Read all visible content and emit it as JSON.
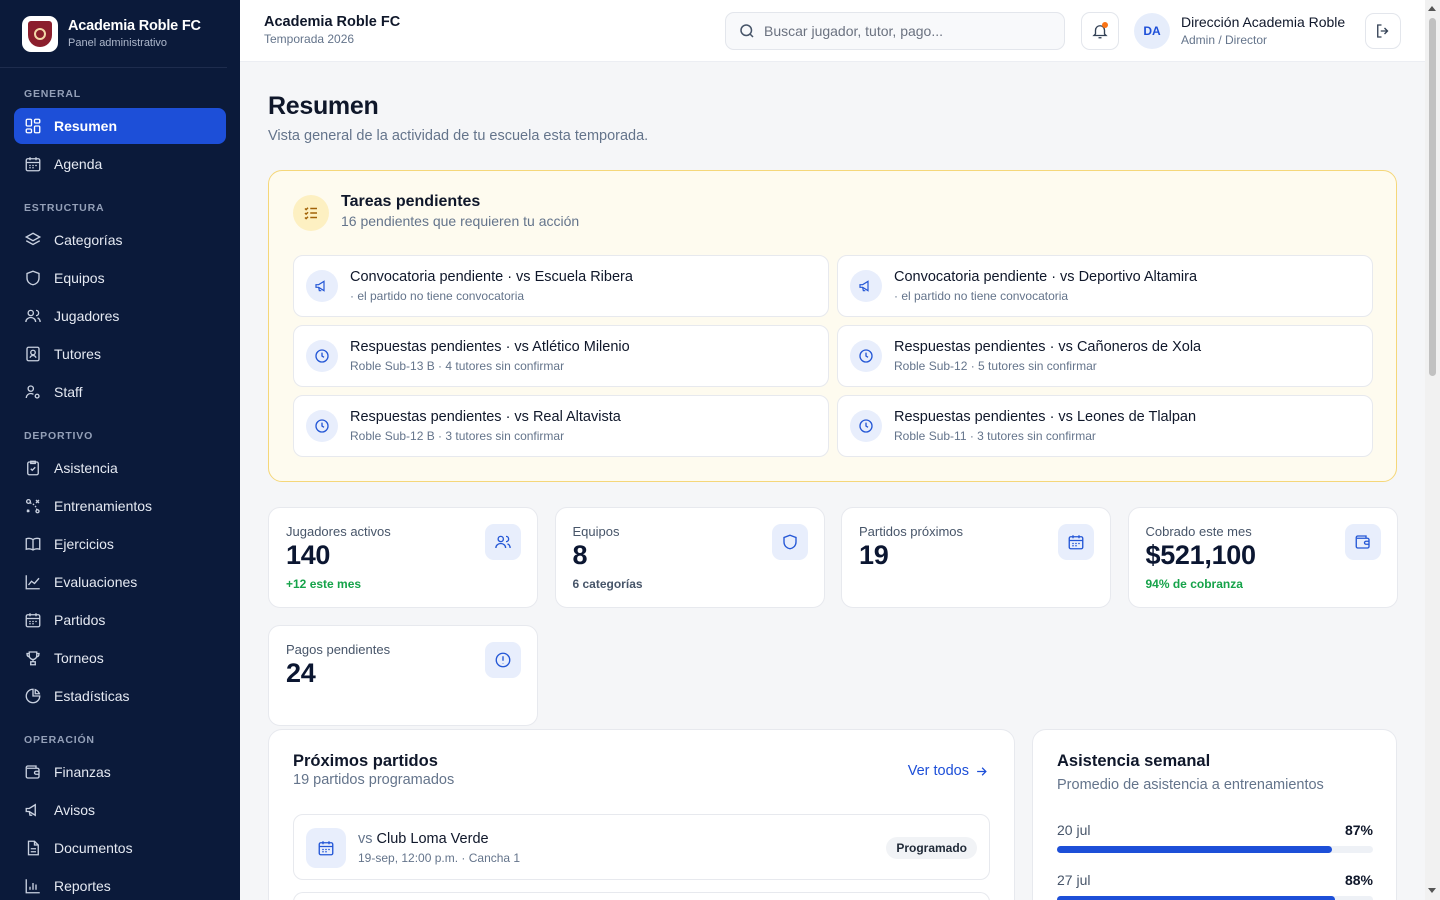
{
  "brand": {
    "title": "Academia Roble FC",
    "subtitle": "Panel administrativo"
  },
  "sidebar": {
    "sections": [
      {
        "label": "GENERAL",
        "items": [
          {
            "label": "Resumen",
            "icon": "grid-icon",
            "active": true
          },
          {
            "label": "Agenda",
            "icon": "calendar-icon"
          }
        ]
      },
      {
        "label": "ESTRUCTURA",
        "items": [
          {
            "label": "Categorías",
            "icon": "layers-icon"
          },
          {
            "label": "Equipos",
            "icon": "shield-icon"
          },
          {
            "label": "Jugadores",
            "icon": "users-icon"
          },
          {
            "label": "Tutores",
            "icon": "id-badge-icon"
          },
          {
            "label": "Staff",
            "icon": "user-cog-icon"
          }
        ]
      },
      {
        "label": "DEPORTIVO",
        "items": [
          {
            "label": "Asistencia",
            "icon": "clipboard-check-icon"
          },
          {
            "label": "Entrenamientos",
            "icon": "tactics-icon"
          },
          {
            "label": "Ejercicios",
            "icon": "book-icon"
          },
          {
            "label": "Evaluaciones",
            "icon": "chart-line-icon"
          },
          {
            "label": "Partidos",
            "icon": "calendar-icon"
          },
          {
            "label": "Torneos",
            "icon": "trophy-icon"
          },
          {
            "label": "Estadísticas",
            "icon": "pie-chart-icon"
          }
        ]
      },
      {
        "label": "OPERACIÓN",
        "items": [
          {
            "label": "Finanzas",
            "icon": "wallet-icon"
          },
          {
            "label": "Avisos",
            "icon": "megaphone-icon"
          },
          {
            "label": "Documentos",
            "icon": "file-icon"
          },
          {
            "label": "Reportes",
            "icon": "bar-chart-icon"
          }
        ]
      }
    ]
  },
  "header": {
    "title": "Academia Roble FC",
    "subtitle": "Temporada 2026",
    "search_placeholder": "Buscar jugador, tutor, pago...",
    "user_initials": "DA",
    "user_name": "Dirección Academia Roble",
    "user_role": "Admin / Director"
  },
  "page": {
    "title": "Resumen",
    "subtitle": "Vista general de la actividad de tu escuela esta temporada."
  },
  "tasks": {
    "title": "Tareas pendientes",
    "subtitle": "16 pendientes que requieren tu acción",
    "items": [
      {
        "title": "Convocatoria pendiente · vs Escuela Ribera",
        "detail": "· el partido no tiene convocatoria",
        "icon": "megaphone-icon"
      },
      {
        "title": "Convocatoria pendiente · vs Deportivo Altamira",
        "detail": "· el partido no tiene convocatoria",
        "icon": "megaphone-icon"
      },
      {
        "title": "Respuestas pendientes · vs Atlético Milenio",
        "detail": "Roble Sub-13 B · 4 tutores sin confirmar",
        "icon": "clock-icon"
      },
      {
        "title": "Respuestas pendientes · vs Cañoneros de Xola",
        "detail": "Roble Sub-12 · 5 tutores sin confirmar",
        "icon": "clock-icon"
      },
      {
        "title": "Respuestas pendientes · vs Real Altavista",
        "detail": "Roble Sub-12 B · 3 tutores sin confirmar",
        "icon": "clock-icon"
      },
      {
        "title": "Respuestas pendientes · vs Leones de Tlalpan",
        "detail": "Roble Sub-11 · 3 tutores sin confirmar",
        "icon": "clock-icon"
      }
    ]
  },
  "stats": [
    {
      "label": "Jugadores activos",
      "value": "140",
      "note": "+12 este mes",
      "note_color": "green",
      "icon": "users-icon"
    },
    {
      "label": "Equipos",
      "value": "8",
      "note": "6 categorías",
      "note_color": "gray",
      "icon": "shield-icon"
    },
    {
      "label": "Partidos próximos",
      "value": "19",
      "note": "",
      "note_color": "gray",
      "icon": "calendar-icon"
    },
    {
      "label": "Cobrado este mes",
      "value": "$521,100",
      "note": "94% de cobranza",
      "note_color": "green",
      "icon": "wallet-icon"
    },
    {
      "label": "Pagos pendientes",
      "value": "24",
      "note": "",
      "note_color": "gray",
      "icon": "alert-circle-icon"
    }
  ],
  "matches": {
    "title": "Próximos partidos",
    "subtitle": "19 partidos programados",
    "see_all": "Ver todos",
    "items": [
      {
        "vs": "vs",
        "opponent": "Club Loma Verde",
        "detail": "19-sep, 12:00 p.m. · Cancha 1",
        "status": "Programado"
      }
    ]
  },
  "attendance": {
    "title": "Asistencia semanal",
    "subtitle": "Promedio de asistencia a entrenamientos",
    "rows": [
      {
        "date": "20 jul",
        "percent_label": "87%",
        "percent": 87
      },
      {
        "date": "27 jul",
        "percent_label": "88%",
        "percent": 88
      }
    ]
  },
  "colors": {
    "sidebar_bg": "#0b1a3a",
    "accent": "#1d4fd8",
    "tasks_bg": "#fefbef",
    "tasks_border": "#f5d77a",
    "positive": "#16a34a"
  }
}
